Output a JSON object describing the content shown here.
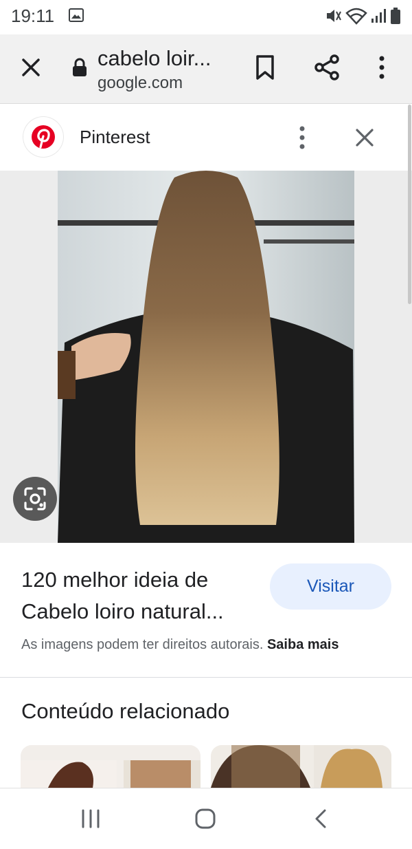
{
  "status_bar": {
    "time": "19:11",
    "icons": [
      "gallery-icon",
      "mute-icon",
      "wifi-icon",
      "signal-icon",
      "battery-icon"
    ]
  },
  "browser": {
    "page_title": "cabelo loir...",
    "domain": "google.com",
    "icons": [
      "close-icon",
      "lock-icon",
      "bookmark-icon",
      "share-icon",
      "more-vert-icon"
    ]
  },
  "viewer": {
    "source_name": "Pinterest",
    "icons": [
      "pinterest-logo",
      "more-vert-icon",
      "close-icon",
      "lens-icon"
    ]
  },
  "result": {
    "title": "120 melhor ideia de Cabelo loiro natural...",
    "visit_label": "Visitar",
    "rights_text": "As imagens podem ter direitos autorais.",
    "learn_more_label": "Saiba mais"
  },
  "related": {
    "heading": "Conteúdo relacionado"
  },
  "colors": {
    "accent": "#1a57b8",
    "visit_bg": "#e8f0fe",
    "pinterest_red": "#e60023"
  }
}
